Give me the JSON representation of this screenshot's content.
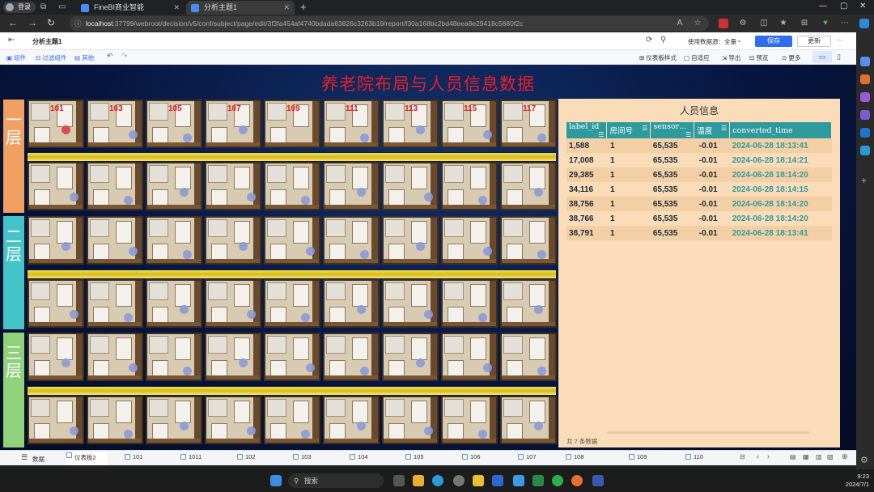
{
  "browser": {
    "login_label": "登录",
    "tabs": [
      {
        "title": "FineBI商业智能"
      },
      {
        "title": "分析主题1"
      }
    ],
    "new_tab_symbol": "+",
    "url_host": "localhost",
    "url_rest": ":37799/webroot/decision/v5/conf/subject/page/edit/3f3fa454af4740bdada63826c3263b19/report/f30a168bc2bd48eea8e29418c5680f2c"
  },
  "app": {
    "subject_title": "分析主题1",
    "data_used_label": "使用数据源：全量",
    "save_label": "保存",
    "update_label": "更新",
    "more_label": "···",
    "toolbar_left": [
      "组件",
      "过滤组件",
      "其他"
    ],
    "toolbar_right": [
      "仪表板样式",
      "自适应",
      "导出",
      "预览",
      "更多"
    ]
  },
  "dashboard": {
    "title": "养老院布局与人员信息数据",
    "floors": [
      "一层",
      "二层",
      "三层"
    ],
    "room_numbers": [
      "101",
      "103",
      "105",
      "107",
      "109",
      "111",
      "113",
      "115",
      "117"
    ],
    "floor_colors": [
      "#f0a060",
      "#45c4c8",
      "#8fd27a"
    ]
  },
  "info_panel": {
    "title": "人员信息",
    "columns": [
      "label_id",
      "房间号",
      "sensor…",
      "温度",
      "converted_time"
    ],
    "rows": [
      [
        "1,588",
        "1",
        "65,535",
        "-0.01",
        "2024-06-28 18:13:41"
      ],
      [
        "17,008",
        "1",
        "65,535",
        "-0.01",
        "2024-06-28 18:14:21"
      ],
      [
        "29,385",
        "1",
        "65,535",
        "-0.01",
        "2024-06-28 18:14:20"
      ],
      [
        "34,116",
        "1",
        "65,535",
        "-0.01",
        "2024-06-28 18:14:15"
      ],
      [
        "38,756",
        "1",
        "65,535",
        "-0.01",
        "2024-06-28 18:14:20"
      ],
      [
        "38,766",
        "1",
        "65,535",
        "-0.01",
        "2024-06-28 18:14:20"
      ],
      [
        "38,791",
        "1",
        "65,535",
        "-0.01",
        "2024-06-28 18:13:41"
      ]
    ],
    "total_text": "共 7 条数据"
  },
  "sheets": {
    "data_label": "数据",
    "tabs": [
      "仪表板2",
      "101",
      "1011",
      "102",
      "103",
      "104",
      "105",
      "106",
      "107",
      "108",
      "109",
      "110"
    ],
    "active_index": 0
  },
  "taskbar": {
    "search_placeholder": "搜索",
    "time": "9:23",
    "date": "2024/7/1"
  }
}
